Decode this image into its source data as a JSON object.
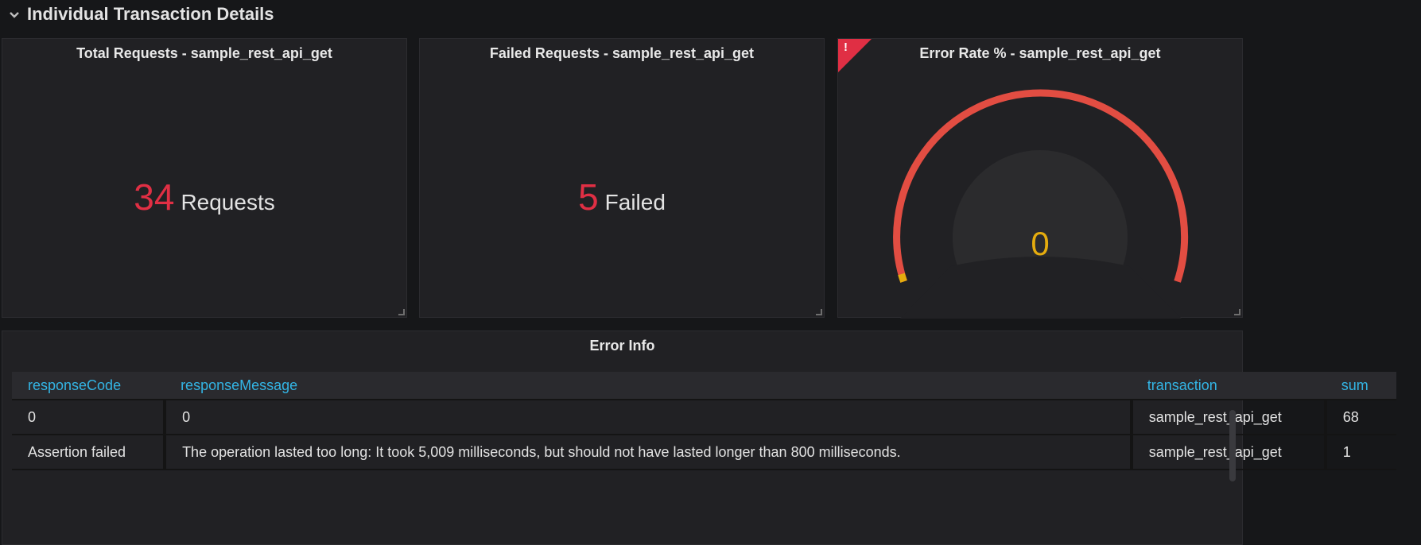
{
  "row": {
    "title": "Individual Transaction Details",
    "chevron_icon": "chevron-down-icon"
  },
  "panels": {
    "total_requests": {
      "title": "Total Requests - sample_rest_api_get",
      "value": "34",
      "unit": "Requests",
      "value_color": "#e02f44"
    },
    "failed_requests": {
      "title": "Failed Requests - sample_rest_api_get",
      "value": "5",
      "unit": "Failed",
      "value_color": "#e02f44"
    },
    "error_rate": {
      "title": "Error Rate % - sample_rest_api_get",
      "value": "0",
      "alert_icon": "alert-triangle-icon",
      "alert_mark": "!",
      "threshold_color": "#e24d42",
      "value_color": "#e5ac0e"
    },
    "error_info": {
      "title": "Error Info",
      "columns": [
        "responseCode",
        "responseMessage",
        "transaction",
        "sum"
      ],
      "rows": [
        [
          "0",
          "0",
          "sample_rest_api_get",
          "68"
        ],
        [
          "Assertion failed",
          "The operation lasted too long: It took 5,009 milliseconds, but should not have lasted longer than 800 milliseconds.",
          "sample_rest_api_get",
          "1"
        ]
      ],
      "header_color": "#33b5e5"
    }
  }
}
